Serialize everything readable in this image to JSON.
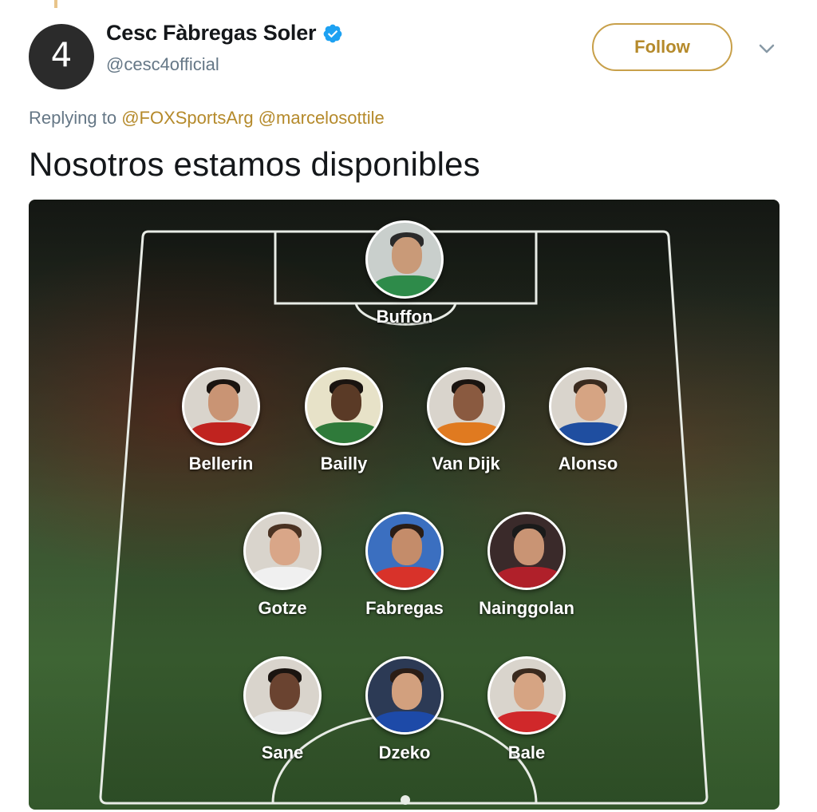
{
  "tweet": {
    "author": {
      "display_name": "Cesc Fàbregas Soler",
      "handle": "@cesc4official",
      "avatar_glyph": "4",
      "verified": true
    },
    "follow_label": "Follow",
    "replying_prefix": "Replying to",
    "replying_to": [
      "@FOXSportsArg",
      "@marcelosottile"
    ],
    "text": "Nosotros estamos disponibles"
  },
  "lineup": {
    "goalkeeper": [
      {
        "name": "Buffon",
        "shirt": "#2e8b4a",
        "skin": "#c99a78",
        "hair": "#2a2a2a"
      }
    ],
    "defenders": [
      {
        "name": "Bellerin",
        "shirt": "#c0231f",
        "skin": "#c99474",
        "hair": "#1a1410"
      },
      {
        "name": "Bailly",
        "shirt": "#2f7a3a",
        "skin": "#5a3a26",
        "hair": "#1a1410"
      },
      {
        "name": "Van Dijk",
        "shirt": "#e07a20",
        "skin": "#8a5a40",
        "hair": "#1a1410"
      },
      {
        "name": "Alonso",
        "shirt": "#1f4ea0",
        "skin": "#d6a483",
        "hair": "#3a2a1e"
      }
    ],
    "midfielders": [
      {
        "name": "Gotze",
        "shirt": "#f0f0f0",
        "skin": "#d9a688",
        "hair": "#4a3222"
      },
      {
        "name": "Fabregas",
        "shirt": "#d8322a",
        "skin": "#c48c6a",
        "hair": "#2a1d16"
      },
      {
        "name": "Nainggolan",
        "shirt": "#b0202a",
        "skin": "#c99474",
        "hair": "#1a1a1a"
      }
    ],
    "forwards": [
      {
        "name": "Sane",
        "shirt": "#e8e8e8",
        "skin": "#6a4330",
        "hair": "#1a1410"
      },
      {
        "name": "Dzeko",
        "shirt": "#1d4aa8",
        "skin": "#d2a07e",
        "hair": "#2a1d16"
      },
      {
        "name": "Bale",
        "shirt": "#d0282a",
        "skin": "#d6a483",
        "hair": "#3a2a1e"
      }
    ]
  },
  "colors": {
    "accent": "#b58a2b",
    "handle_gray": "#657786",
    "verified_blue": "#1da1f2",
    "pitch_lines": "#e8ece6"
  }
}
